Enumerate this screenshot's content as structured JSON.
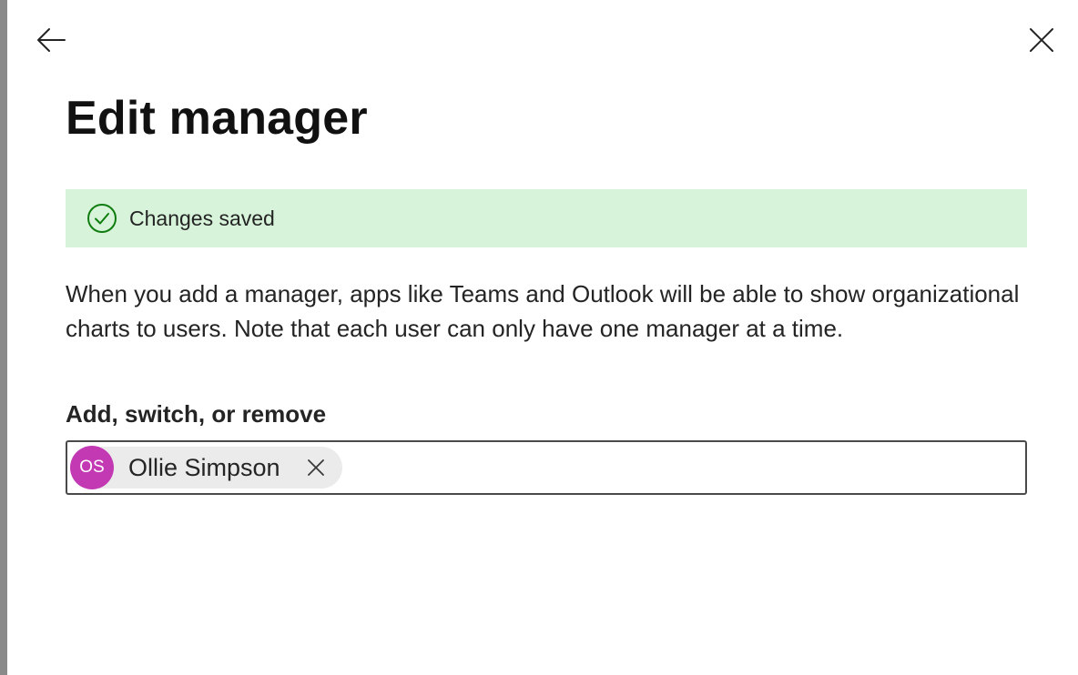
{
  "header": {
    "back_icon": "arrow-left-icon",
    "close_icon": "close-icon"
  },
  "title": "Edit manager",
  "banner": {
    "icon": "checkmark-circle-icon",
    "message": "Changes saved",
    "background": "#d7f4da",
    "icon_color": "#107c10"
  },
  "description": "When you add a manager, apps like Teams and Outlook will be able to show organizational charts to users. Note that each user can only have one manager at a time.",
  "field": {
    "label": "Add, switch, or remove",
    "selected": {
      "initials": "OS",
      "name": "Ollie Simpson",
      "avatar_color": "#c239b3",
      "remove_icon": "close-icon"
    }
  }
}
